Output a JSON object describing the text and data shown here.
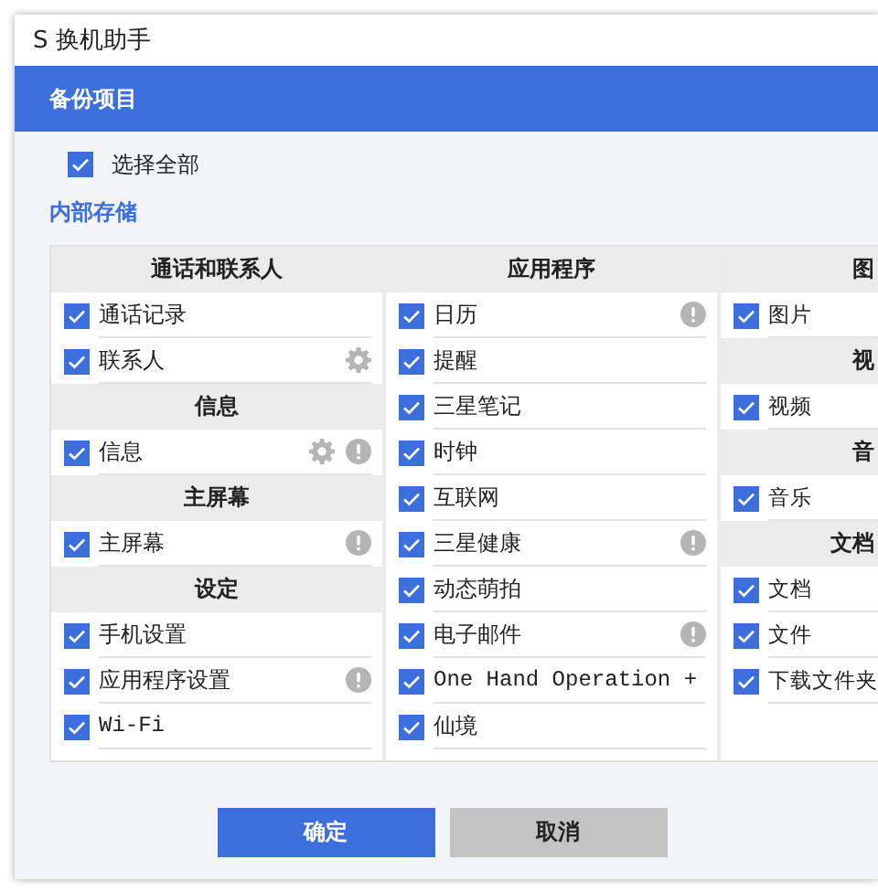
{
  "window": {
    "logo": "S",
    "title": "换机助手"
  },
  "header": {
    "title": "备份项目"
  },
  "select_all": {
    "label": "选择全部",
    "checked": true
  },
  "storage_label": "内部存储",
  "columns": [
    {
      "groups": [
        {
          "title": "通话和联系人",
          "items": [
            {
              "label": "通话记录",
              "checked": true,
              "has_settings": false,
              "has_notice": false
            },
            {
              "label": "联系人",
              "checked": true,
              "has_settings": true,
              "has_notice": false
            }
          ]
        },
        {
          "title": "信息",
          "items": [
            {
              "label": "信息",
              "checked": true,
              "has_settings": true,
              "has_notice": true
            }
          ]
        },
        {
          "title": "主屏幕",
          "items": [
            {
              "label": "主屏幕",
              "checked": true,
              "has_settings": false,
              "has_notice": true
            }
          ]
        },
        {
          "title": "设定",
          "items": [
            {
              "label": "手机设置",
              "checked": true,
              "has_settings": false,
              "has_notice": false
            },
            {
              "label": "应用程序设置",
              "checked": true,
              "has_settings": false,
              "has_notice": true
            },
            {
              "label": "Wi-Fi",
              "checked": true,
              "has_settings": false,
              "has_notice": false
            }
          ]
        }
      ]
    },
    {
      "groups": [
        {
          "title": "应用程序",
          "items": [
            {
              "label": "日历",
              "checked": true,
              "has_settings": false,
              "has_notice": true
            },
            {
              "label": "提醒",
              "checked": true,
              "has_settings": false,
              "has_notice": false
            },
            {
              "label": "三星笔记",
              "checked": true,
              "has_settings": false,
              "has_notice": false
            },
            {
              "label": "时钟",
              "checked": true,
              "has_settings": false,
              "has_notice": false
            },
            {
              "label": "互联网",
              "checked": true,
              "has_settings": false,
              "has_notice": false
            },
            {
              "label": "三星健康",
              "checked": true,
              "has_settings": false,
              "has_notice": true
            },
            {
              "label": "动态萌拍",
              "checked": true,
              "has_settings": false,
              "has_notice": false
            },
            {
              "label": "电子邮件",
              "checked": true,
              "has_settings": false,
              "has_notice": true
            },
            {
              "label": "One Hand Operation +",
              "checked": true,
              "has_settings": false,
              "has_notice": false
            },
            {
              "label": "仙境",
              "checked": true,
              "has_settings": false,
              "has_notice": false
            }
          ]
        }
      ]
    },
    {
      "groups": [
        {
          "title": "图",
          "items": [
            {
              "label": "图片",
              "checked": true,
              "has_settings": false,
              "has_notice": false
            }
          ]
        },
        {
          "title": "视",
          "items": [
            {
              "label": "视频",
              "checked": true,
              "has_settings": false,
              "has_notice": false
            }
          ]
        },
        {
          "title": "音",
          "items": [
            {
              "label": "音乐",
              "checked": true,
              "has_settings": false,
              "has_notice": false
            }
          ]
        },
        {
          "title": "文档",
          "items": [
            {
              "label": "文档",
              "checked": true,
              "has_settings": false,
              "has_notice": false
            },
            {
              "label": "文件",
              "checked": true,
              "has_settings": false,
              "has_notice": false
            },
            {
              "label": "下载文件夹",
              "checked": true,
              "has_settings": false,
              "has_notice": false
            }
          ]
        }
      ]
    }
  ],
  "buttons": [
    {
      "label": "确定",
      "kind": "primary"
    },
    {
      "label": "取消",
      "kind": "secondary"
    }
  ]
}
